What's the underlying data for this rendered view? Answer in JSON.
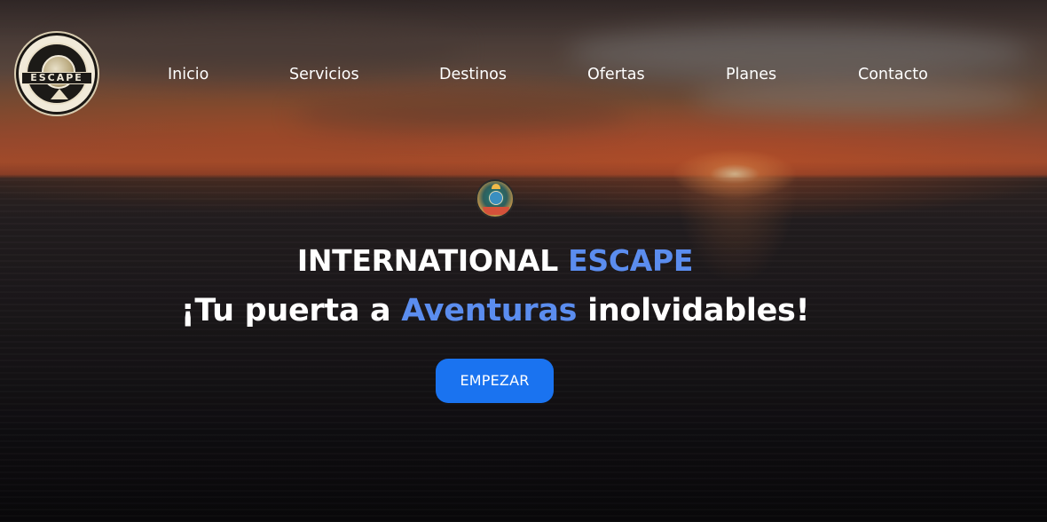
{
  "nav": {
    "logo_text": "ESCAPE",
    "items": [
      {
        "label": "Inicio"
      },
      {
        "label": "Servicios"
      },
      {
        "label": "Destinos"
      },
      {
        "label": "Ofertas"
      },
      {
        "label": "Planes"
      },
      {
        "label": "Contacto"
      }
    ]
  },
  "hero": {
    "title_part1": "INTERNATIONAL ",
    "title_accent": "ESCAPE",
    "subtitle_part1": "¡Tu puerta a ",
    "subtitle_accent": "Aventuras",
    "subtitle_part2": " inolvidables!",
    "cta_label": "EMPEZAR"
  },
  "colors": {
    "accent": "#5b8def",
    "button": "#1a73f0",
    "text": "#ffffff"
  },
  "icons": {
    "logo": "escape-logo-icon",
    "emblem": "travel-emblem-icon"
  }
}
